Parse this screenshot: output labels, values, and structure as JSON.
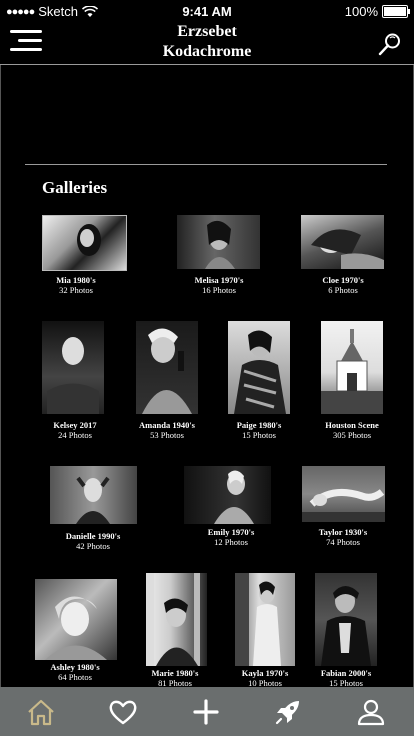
{
  "status_bar": {
    "carrier": "Sketch",
    "time": "9:41 AM",
    "battery": "100%"
  },
  "header": {
    "title_line1": "Erzsebet",
    "title_line2": "Kodachrome"
  },
  "section": {
    "title": "Galleries"
  },
  "galleries": [
    {
      "name": "Mia 1980's",
      "count": "32 Photos"
    },
    {
      "name": "Melisa 1970's",
      "count": "16 Photos"
    },
    {
      "name": "Cloe 1970's",
      "count": "6 Photos"
    },
    {
      "name": "Kelsey 2017",
      "count": "24 Photos"
    },
    {
      "name": "Amanda 1940's",
      "count": "53 Photos"
    },
    {
      "name": "Paige 1980's",
      "count": "15 Photos"
    },
    {
      "name": "Houston  Scene",
      "count": "305 Photos"
    },
    {
      "name": "Danielle 1990's",
      "count": "42 Photos"
    },
    {
      "name": "Emily 1970's",
      "count": "12 Photos"
    },
    {
      "name": "Taylor 1930's",
      "count": "74 Photos"
    },
    {
      "name": "Ashley 1980's",
      "count": "64 Photos"
    },
    {
      "name": "Marie 1980's",
      "count": "81 Photos"
    },
    {
      "name": "Kayla 1970's",
      "count": "10 Photos"
    },
    {
      "name": "Fabian 2000's",
      "count": "15 Photos"
    }
  ],
  "tabbar": {
    "items": [
      {
        "icon": "home-icon",
        "active": true
      },
      {
        "icon": "heart-icon",
        "active": false
      },
      {
        "icon": "plus-icon",
        "active": false
      },
      {
        "icon": "rocket-icon",
        "active": false
      },
      {
        "icon": "profile-icon",
        "active": false
      }
    ],
    "active_color": "#c9b98a",
    "background": "#6a6e6e"
  }
}
